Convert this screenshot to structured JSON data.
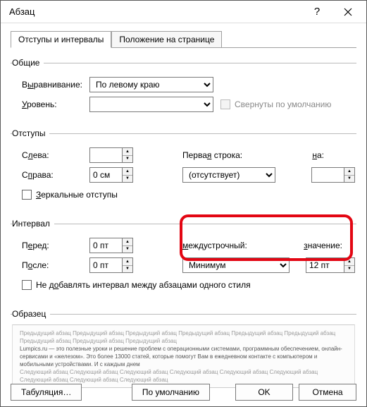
{
  "title": "Абзац",
  "tabs": {
    "indent": "Отступы и интервалы",
    "position": "Положение на странице"
  },
  "groups": {
    "general": "Общие",
    "indents": "Отступы",
    "spacing": "Интервал",
    "preview": "Образец"
  },
  "general": {
    "alignment_label_pre": "В",
    "alignment_label_u": "ы",
    "alignment_label_post": "равнивание:",
    "alignment_value": "По левому краю",
    "level_label_pre": "",
    "level_label_u": "У",
    "level_label_post": "ровень:",
    "level_value": "",
    "collapse_label": "Свернуты по умолчанию"
  },
  "indents": {
    "left_label_pre": "С",
    "left_label_u": "л",
    "left_label_post": "ева:",
    "left_value": "",
    "right_label_pre": "С",
    "right_label_u": "п",
    "right_label_post": "рава:",
    "right_value": "0 см",
    "first_label_pre": "Перва",
    "first_label_u": "я",
    "first_label_post": " строка:",
    "first_value": "(отсутствует)",
    "by_label_pre": "",
    "by_label_u": "н",
    "by_label_post": "а:",
    "by_value": "",
    "mirror_label_pre": "",
    "mirror_label_u": "З",
    "mirror_label_post": "еркальные отступы"
  },
  "spacing": {
    "before_label_pre": "П",
    "before_label_u": "е",
    "before_label_post": "ред:",
    "before_value": "0 пт",
    "after_label_pre": "П",
    "after_label_u": "о",
    "after_label_post": "сле:",
    "after_value": "0 пт",
    "line_label_pre": "",
    "line_label_u": "м",
    "line_label_post": "еждустрочный:",
    "line_value": "Минимум",
    "at_label_pre": "",
    "at_label_u": "з",
    "at_label_post": "начение:",
    "at_value": "12 пт",
    "nospace_label_pre": "Не д",
    "nospace_label_u": "о",
    "nospace_label_post": "бавлять интервал между абзацами одного стиля"
  },
  "preview_text": {
    "prev": "Предыдущий абзац Предыдущий абзац Предыдущий абзац Предыдущий абзац Предыдущий абзац Предыдущий абзац Предыдущий абзац Предыдущий абзац Предыдущий абзац",
    "body": "Lumpics.ru — это полезные уроки и решение проблем с операционными системами, программным обеспечением, онлайн-сервисами и «железом». Это более 13000 статей, которые помогут Вам в ежедневном контакте с компьютером и мобильными устройствами. И с каждым днем",
    "next": "Следующий абзац Следующий абзац Следующий абзац Следующий абзац Следующий абзац Следующий абзац Следующий абзац Следующий абзац Следующий абзац"
  },
  "buttons": {
    "tabs": "Табуляция…",
    "default": "По умолчанию",
    "ok": "OK",
    "cancel": "Отмена"
  }
}
